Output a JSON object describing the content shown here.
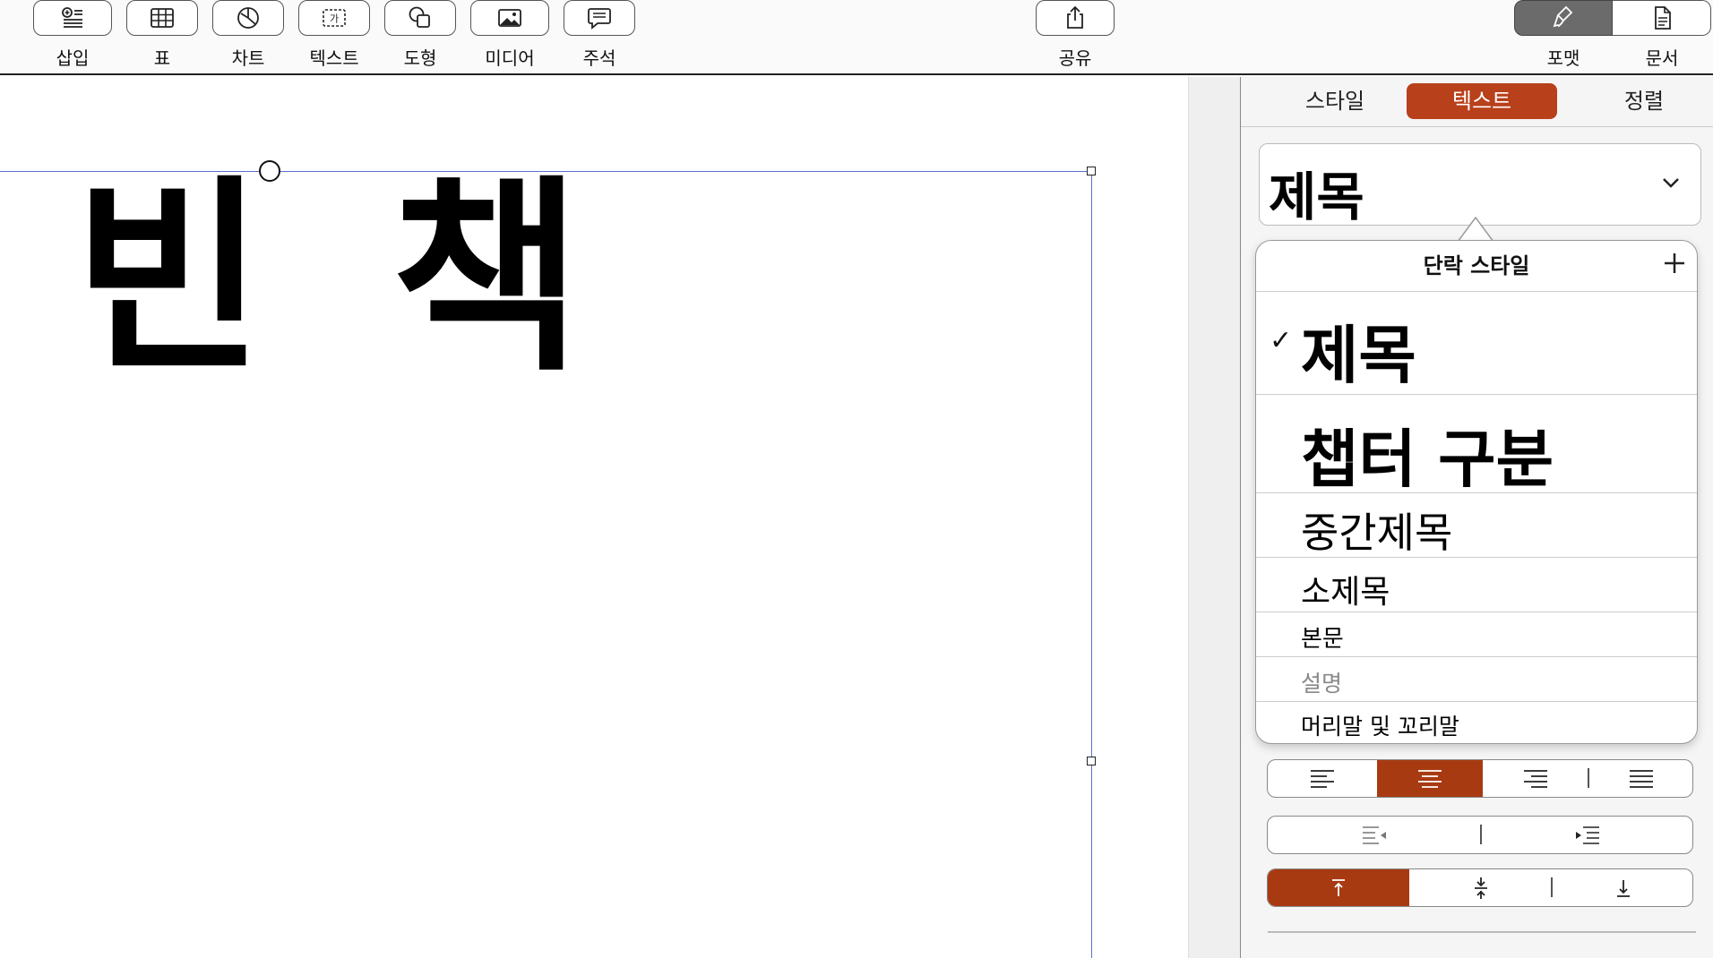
{
  "toolbar": {
    "insert_label": "삽입",
    "table_label": "표",
    "chart_label": "차트",
    "text_label": "텍스트",
    "text_icon_glyph": "가",
    "shape_label": "도형",
    "media_label": "미디어",
    "comment_label": "주석",
    "share_label": "공유",
    "format_label": "포맷",
    "document_label": "문서"
  },
  "canvas": {
    "title_text": "빈 책"
  },
  "inspector": {
    "tabs": [
      "스타일",
      "텍스트",
      "정렬"
    ],
    "active_tab": "텍스트",
    "paragraph_style_value": "제목",
    "accent_color": "#b8401a"
  },
  "popover": {
    "header": "단락 스타일",
    "check_glyph": "✓",
    "styles": [
      {
        "label": "제목",
        "selected": true
      },
      {
        "label": "챕터 구분",
        "selected": false
      },
      {
        "label": "중간제목",
        "selected": false
      },
      {
        "label": "소제목",
        "selected": false
      },
      {
        "label": "본문",
        "selected": false
      },
      {
        "label": "설명",
        "selected": false
      },
      {
        "label": "머리말 및 꼬리말",
        "selected": false
      }
    ]
  },
  "alignment": {
    "horizontal_selected": "center",
    "vertical_selected": "top"
  }
}
